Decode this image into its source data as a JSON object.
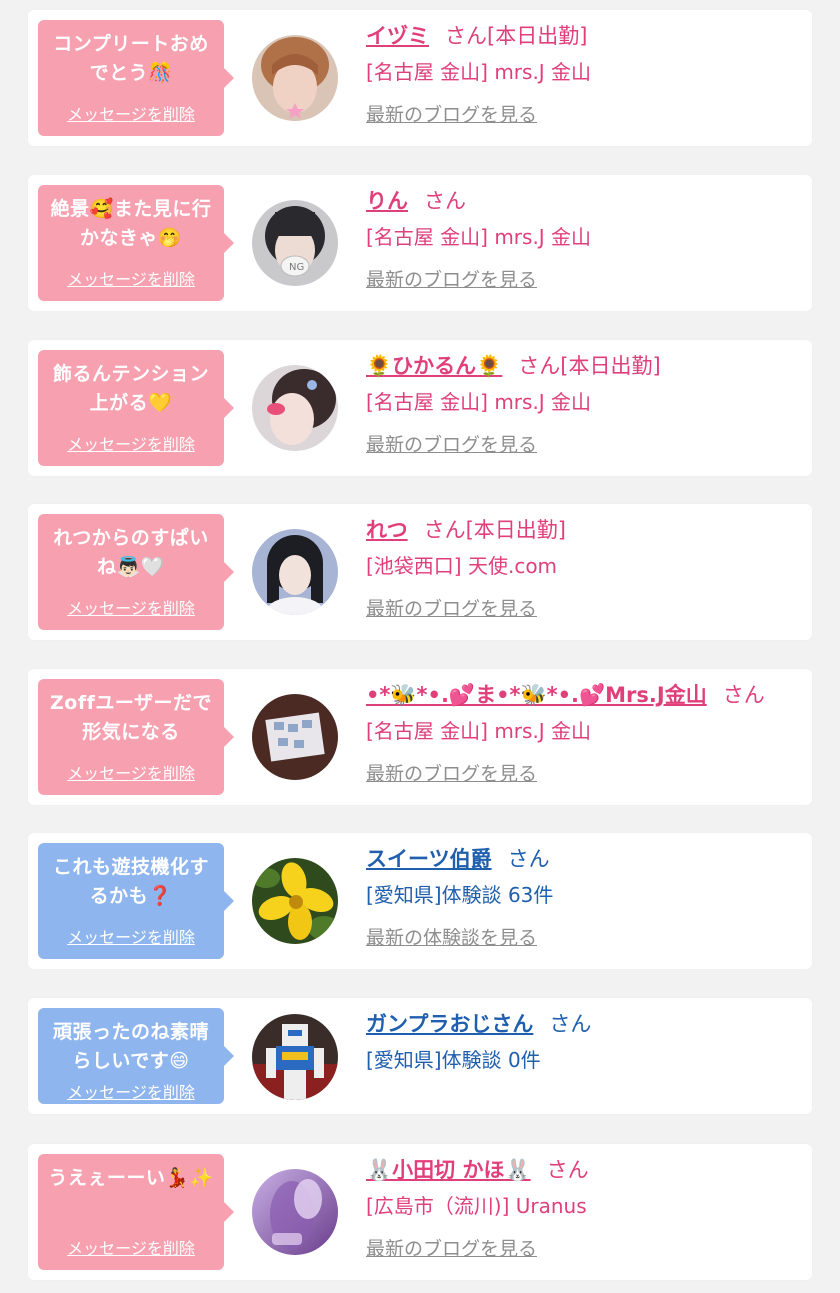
{
  "common": {
    "delete_label": "メッセージを削除"
  },
  "cards": [
    {
      "message": "コンプリートおめでとう🎊",
      "name": "イヅミ",
      "honorific": "さん[本日出勤]",
      "shop": "[名古屋 金山] mrs.J 金山",
      "link": "最新のブログを見る",
      "theme": "pink"
    },
    {
      "message": "絶景🥰また見に行かなきゃ🤭",
      "name": "りん",
      "honorific": "さん",
      "shop": "[名古屋 金山] mrs.J 金山",
      "link": "最新のブログを見る",
      "theme": "pink"
    },
    {
      "message": "飾るんテンション上がる💛",
      "name": "🌻ひかるん🌻",
      "honorific": "さん[本日出勤]",
      "shop": "[名古屋 金山] mrs.J 金山",
      "link": "最新のブログを見る",
      "theme": "pink"
    },
    {
      "message": "れつからのすぱいね👼🏻🤍",
      "name": "れつ",
      "honorific": "さん[本日出勤]",
      "shop": "[池袋西口] 天使.com",
      "link": "最新のブログを見る",
      "theme": "pink"
    },
    {
      "message": "Zoffユーザーだで形気になる",
      "name": "•*🐝*•.💕ま•*🐝*•.💕Mrs.J金山",
      "honorific": "さん",
      "shop": "[名古屋 金山] mrs.J 金山",
      "link": "最新のブログを見る",
      "theme": "pink"
    },
    {
      "message": "これも遊技機化するかも❓",
      "name": "スイーツ伯爵",
      "honorific": "さん",
      "shop": "[愛知県]体験談 63件",
      "link": "最新の体験談を見る",
      "theme": "blue"
    },
    {
      "message": "頑張ったのね素晴らしいです😄",
      "name": "ガンプラおじさん",
      "honorific": "さん",
      "shop": "[愛知県]体験談 0件",
      "link": "",
      "theme": "blue"
    },
    {
      "message": "うえぇーーい💃✨",
      "name": "🐰小田切 かほ🐰",
      "honorific": "さん",
      "shop": "[広島市（流川)] Uranus",
      "link": "最新のブログを見る",
      "theme": "pink"
    }
  ]
}
